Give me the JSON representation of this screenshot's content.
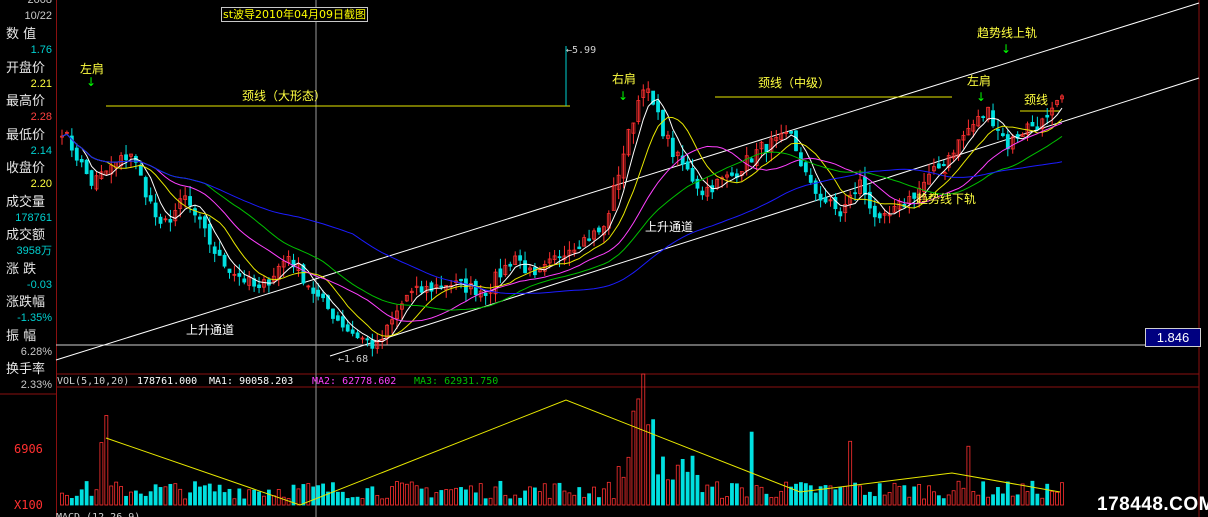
{
  "title": "st波导2010年04月09日截图",
  "sidebar": {
    "top_partial": "2008",
    "date": "10/22",
    "items": [
      {
        "label": "数  值",
        "value": "1.76",
        "color": "#00d0d0"
      },
      {
        "label": "开盘价",
        "value": "2.21",
        "color": "#ffff40"
      },
      {
        "label": "最高价",
        "value": "2.28",
        "color": "#ff4040"
      },
      {
        "label": "最低价",
        "value": "2.14",
        "color": "#00d0d0"
      },
      {
        "label": "收盘价",
        "value": "2.20",
        "color": "#ffff40"
      },
      {
        "label": "成交量",
        "value": "178761",
        "color": "#00d0d0"
      },
      {
        "label": "成交额",
        "value": "3958万",
        "color": "#00d0d0"
      },
      {
        "label": "涨  跌",
        "value": "-0.03",
        "color": "#00d0d0"
      },
      {
        "label": "涨跌幅",
        "value": "-1.35%",
        "color": "#00d0d0"
      },
      {
        "label": "振  幅",
        "value": "6.28%",
        "color": "#c8c8c8"
      },
      {
        "label": "换手率",
        "value": "2.33%",
        "color": "#c8c8c8"
      }
    ]
  },
  "annotations": {
    "left_shoulder_1": "左肩",
    "neckline_large": "颈线（大形态）",
    "right_shoulder": "右肩",
    "neckline_mid": "颈线（中级）",
    "trend_upper": "趋势线上轨",
    "left_shoulder_2": "左肩",
    "neckline_small": "颈线",
    "trend_lower": "趋势线下轨",
    "up_channel_1": "上升通道",
    "up_channel_2": "上升通道",
    "high_label": "5.99",
    "low_label": "1.68"
  },
  "current_price": "1.846",
  "volume_panel": {
    "vol_label": "VOL(5,10,20)",
    "vol_value": "178761.000",
    "ma1": "MA1: 90058.203",
    "ma2": "MA2: 62778.602",
    "ma3": "MA3: 62931.750",
    "axis_value": "6906",
    "axis_unit": "X100",
    "bottom_partial": "MACD (12,26,9)"
  },
  "watermark": "178448.COM",
  "colors": {
    "price_ma1": "#ffffff",
    "ma_yellow": "#e8e800",
    "ma_magenta": "#ff40ff",
    "ma_green": "#00c000",
    "ma_white": "#d0d0d0",
    "ma_blue": "#1c1cff",
    "up_candle": "#ff3030",
    "down_candle": "#00e0e0",
    "annotation_text": "#ffff40",
    "arrow_green": "#00ff00",
    "arrow_red": "#ff2020"
  },
  "chart_data": {
    "type": "candlestick",
    "pivots": [
      {
        "i": 0,
        "p": 2.6
      },
      {
        "i": 6,
        "p": 2.25
      },
      {
        "i": 14,
        "p": 2.45
      },
      {
        "i": 20,
        "p": 1.95
      },
      {
        "i": 25,
        "p": 2.15
      },
      {
        "i": 32,
        "p": 1.75
      },
      {
        "i": 40,
        "p": 1.55
      },
      {
        "i": 46,
        "p": 1.78
      },
      {
        "i": 52,
        "p": 1.5
      },
      {
        "i": 58,
        "p": 1.3
      },
      {
        "i": 64,
        "p": 1.18
      },
      {
        "i": 70,
        "p": 1.52
      },
      {
        "i": 78,
        "p": 1.6
      },
      {
        "i": 86,
        "p": 1.55
      },
      {
        "i": 92,
        "p": 1.78
      },
      {
        "i": 96,
        "p": 1.62
      },
      {
        "i": 102,
        "p": 1.82
      },
      {
        "i": 110,
        "p": 1.95
      },
      {
        "i": 114,
        "p": 2.45
      },
      {
        "i": 118,
        "p": 2.9
      },
      {
        "i": 124,
        "p": 2.45
      },
      {
        "i": 130,
        "p": 2.2
      },
      {
        "i": 136,
        "p": 2.3
      },
      {
        "i": 142,
        "p": 2.48
      },
      {
        "i": 148,
        "p": 2.55
      },
      {
        "i": 152,
        "p": 2.22
      },
      {
        "i": 158,
        "p": 2.05
      },
      {
        "i": 162,
        "p": 2.25
      },
      {
        "i": 166,
        "p": 1.98
      },
      {
        "i": 172,
        "p": 2.15
      },
      {
        "i": 178,
        "p": 2.35
      },
      {
        "i": 184,
        "p": 2.6
      },
      {
        "i": 188,
        "p": 2.72
      },
      {
        "i": 192,
        "p": 2.5
      },
      {
        "i": 196,
        "p": 2.62
      },
      {
        "i": 200,
        "p": 2.65
      },
      {
        "i": 203,
        "p": 2.8
      }
    ],
    "ma_periods": [
      5,
      10,
      20,
      30,
      60
    ]
  }
}
